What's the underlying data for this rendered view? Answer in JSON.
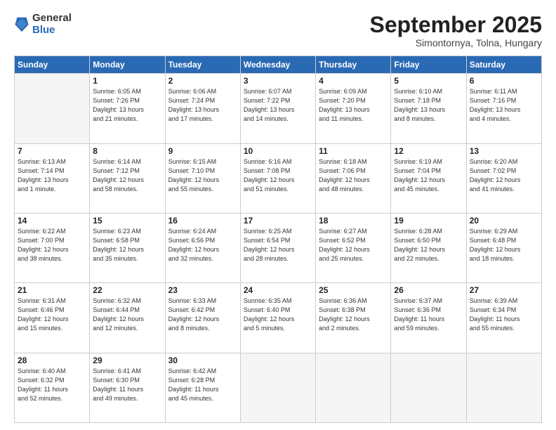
{
  "logo": {
    "general": "General",
    "blue": "Blue"
  },
  "header": {
    "month": "September 2025",
    "location": "Simontornya, Tolna, Hungary"
  },
  "weekdays": [
    "Sunday",
    "Monday",
    "Tuesday",
    "Wednesday",
    "Thursday",
    "Friday",
    "Saturday"
  ],
  "weeks": [
    [
      {
        "day": "",
        "info": ""
      },
      {
        "day": "1",
        "info": "Sunrise: 6:05 AM\nSunset: 7:26 PM\nDaylight: 13 hours\nand 21 minutes."
      },
      {
        "day": "2",
        "info": "Sunrise: 6:06 AM\nSunset: 7:24 PM\nDaylight: 13 hours\nand 17 minutes."
      },
      {
        "day": "3",
        "info": "Sunrise: 6:07 AM\nSunset: 7:22 PM\nDaylight: 13 hours\nand 14 minutes."
      },
      {
        "day": "4",
        "info": "Sunrise: 6:09 AM\nSunset: 7:20 PM\nDaylight: 13 hours\nand 11 minutes."
      },
      {
        "day": "5",
        "info": "Sunrise: 6:10 AM\nSunset: 7:18 PM\nDaylight: 13 hours\nand 8 minutes."
      },
      {
        "day": "6",
        "info": "Sunrise: 6:11 AM\nSunset: 7:16 PM\nDaylight: 13 hours\nand 4 minutes."
      }
    ],
    [
      {
        "day": "7",
        "info": "Sunrise: 6:13 AM\nSunset: 7:14 PM\nDaylight: 13 hours\nand 1 minute."
      },
      {
        "day": "8",
        "info": "Sunrise: 6:14 AM\nSunset: 7:12 PM\nDaylight: 12 hours\nand 58 minutes."
      },
      {
        "day": "9",
        "info": "Sunrise: 6:15 AM\nSunset: 7:10 PM\nDaylight: 12 hours\nand 55 minutes."
      },
      {
        "day": "10",
        "info": "Sunrise: 6:16 AM\nSunset: 7:08 PM\nDaylight: 12 hours\nand 51 minutes."
      },
      {
        "day": "11",
        "info": "Sunrise: 6:18 AM\nSunset: 7:06 PM\nDaylight: 12 hours\nand 48 minutes."
      },
      {
        "day": "12",
        "info": "Sunrise: 6:19 AM\nSunset: 7:04 PM\nDaylight: 12 hours\nand 45 minutes."
      },
      {
        "day": "13",
        "info": "Sunrise: 6:20 AM\nSunset: 7:02 PM\nDaylight: 12 hours\nand 41 minutes."
      }
    ],
    [
      {
        "day": "14",
        "info": "Sunrise: 6:22 AM\nSunset: 7:00 PM\nDaylight: 12 hours\nand 38 minutes."
      },
      {
        "day": "15",
        "info": "Sunrise: 6:23 AM\nSunset: 6:58 PM\nDaylight: 12 hours\nand 35 minutes."
      },
      {
        "day": "16",
        "info": "Sunrise: 6:24 AM\nSunset: 6:56 PM\nDaylight: 12 hours\nand 32 minutes."
      },
      {
        "day": "17",
        "info": "Sunrise: 6:25 AM\nSunset: 6:54 PM\nDaylight: 12 hours\nand 28 minutes."
      },
      {
        "day": "18",
        "info": "Sunrise: 6:27 AM\nSunset: 6:52 PM\nDaylight: 12 hours\nand 25 minutes."
      },
      {
        "day": "19",
        "info": "Sunrise: 6:28 AM\nSunset: 6:50 PM\nDaylight: 12 hours\nand 22 minutes."
      },
      {
        "day": "20",
        "info": "Sunrise: 6:29 AM\nSunset: 6:48 PM\nDaylight: 12 hours\nand 18 minutes."
      }
    ],
    [
      {
        "day": "21",
        "info": "Sunrise: 6:31 AM\nSunset: 6:46 PM\nDaylight: 12 hours\nand 15 minutes."
      },
      {
        "day": "22",
        "info": "Sunrise: 6:32 AM\nSunset: 6:44 PM\nDaylight: 12 hours\nand 12 minutes."
      },
      {
        "day": "23",
        "info": "Sunrise: 6:33 AM\nSunset: 6:42 PM\nDaylight: 12 hours\nand 8 minutes."
      },
      {
        "day": "24",
        "info": "Sunrise: 6:35 AM\nSunset: 6:40 PM\nDaylight: 12 hours\nand 5 minutes."
      },
      {
        "day": "25",
        "info": "Sunrise: 6:36 AM\nSunset: 6:38 PM\nDaylight: 12 hours\nand 2 minutes."
      },
      {
        "day": "26",
        "info": "Sunrise: 6:37 AM\nSunset: 6:36 PM\nDaylight: 11 hours\nand 59 minutes."
      },
      {
        "day": "27",
        "info": "Sunrise: 6:39 AM\nSunset: 6:34 PM\nDaylight: 11 hours\nand 55 minutes."
      }
    ],
    [
      {
        "day": "28",
        "info": "Sunrise: 6:40 AM\nSunset: 6:32 PM\nDaylight: 11 hours\nand 52 minutes."
      },
      {
        "day": "29",
        "info": "Sunrise: 6:41 AM\nSunset: 6:30 PM\nDaylight: 11 hours\nand 49 minutes."
      },
      {
        "day": "30",
        "info": "Sunrise: 6:42 AM\nSunset: 6:28 PM\nDaylight: 11 hours\nand 45 minutes."
      },
      {
        "day": "",
        "info": ""
      },
      {
        "day": "",
        "info": ""
      },
      {
        "day": "",
        "info": ""
      },
      {
        "day": "",
        "info": ""
      }
    ]
  ]
}
